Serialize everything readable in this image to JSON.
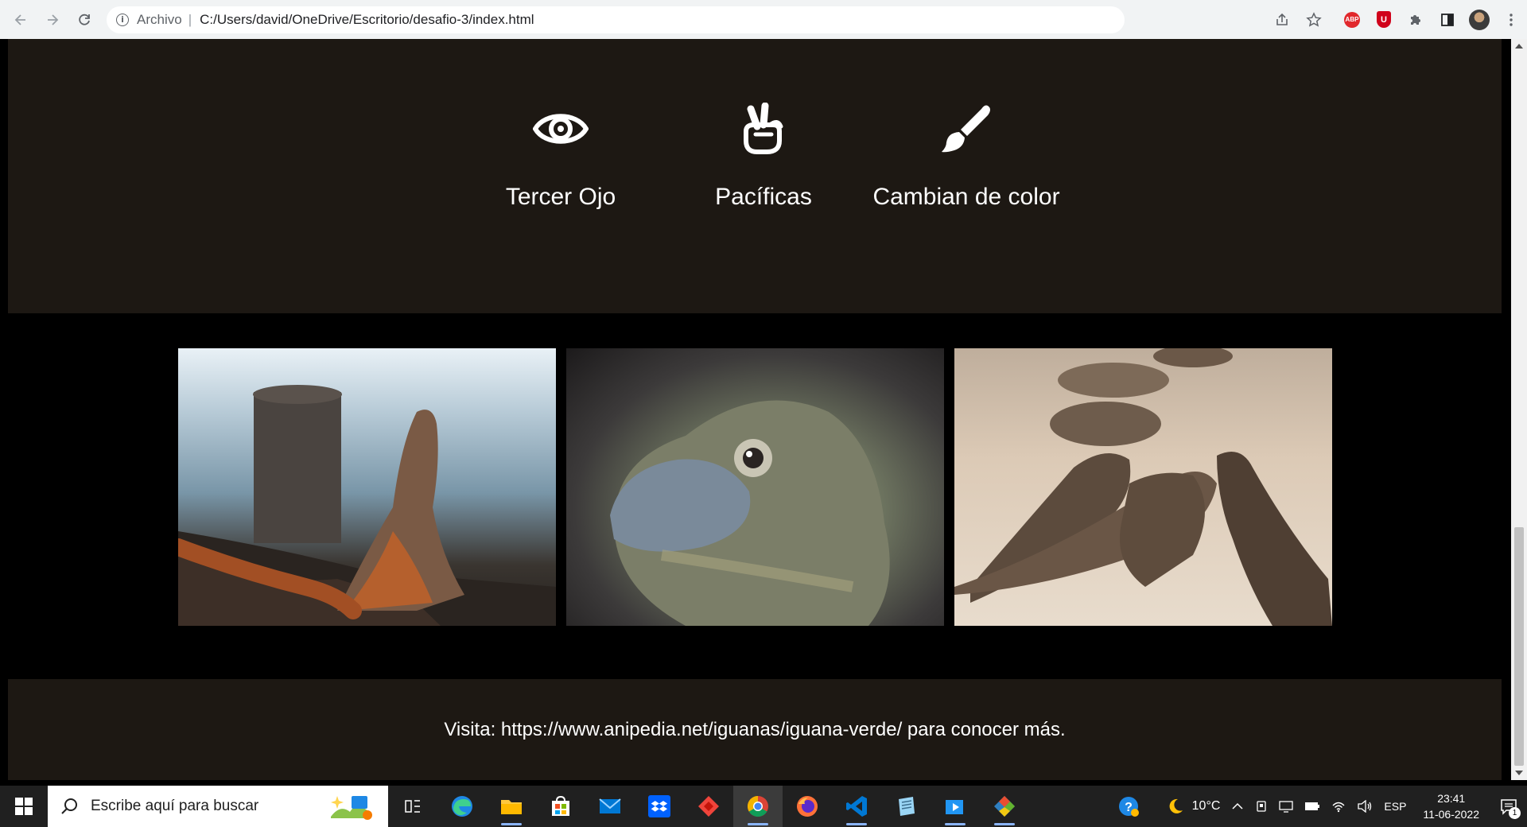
{
  "browser": {
    "scheme_label": "Archivo",
    "separator": "|",
    "url": "C:/Users/david/OneDrive/Escritorio/desafio-3/index.html",
    "extensions": {
      "abp_label": "ABP",
      "ublock_label": "U"
    }
  },
  "features": [
    {
      "label": "Tercer Ojo",
      "icon": "eye-icon"
    },
    {
      "label": "Pacíficas",
      "icon": "peace-hand-icon"
    },
    {
      "label": "Cambian de color",
      "icon": "paint-brush-icon"
    }
  ],
  "gallery": [
    {
      "name": "iguana-on-shore-photo"
    },
    {
      "name": "iguana-closeup-photo"
    },
    {
      "name": "iguanas-on-sand-photo"
    }
  ],
  "footer": {
    "text": "Visita: https://www.anipedia.net/iguanas/iguana-verde/ para conocer más."
  },
  "taskbar": {
    "search_placeholder": "Escribe aquí para buscar",
    "weather": "10°C",
    "language": "ESP",
    "time": "23:41",
    "date": "11-06-2022",
    "notification_count": "1"
  },
  "colors": {
    "band_bg": "#1d1813",
    "page_bg": "#000000",
    "text": "#ffffff"
  }
}
